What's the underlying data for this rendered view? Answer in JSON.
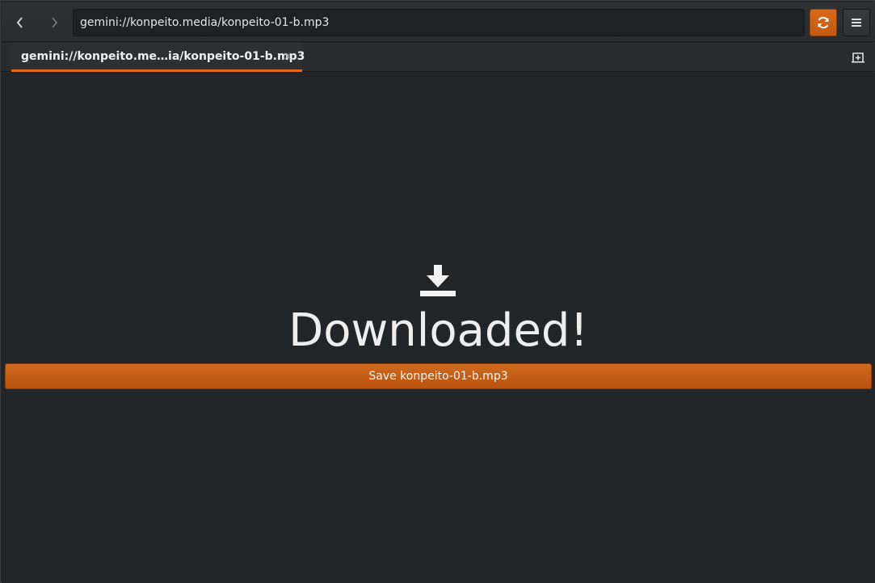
{
  "toolbar": {
    "back_icon": "chevron-left-icon",
    "forward_icon": "chevron-right-icon",
    "url": "gemini://konpeito.media/konpeito-01-b.mp3",
    "reload_icon": "reload-icon",
    "menu_icon": "hamburger-menu-icon",
    "accent_color": "#d8691a"
  },
  "tabs": [
    {
      "label": "gemini://konpeito.me…ia/konpeito-01-b.mp3",
      "close_icon": "×",
      "active": true
    }
  ],
  "tabbar": {
    "new_tab_icon": "new-tab-icon"
  },
  "content": {
    "icon": "download-icon",
    "headline": "Downloaded!",
    "save_button_label": "Save konpeito-01-b.mp3"
  }
}
